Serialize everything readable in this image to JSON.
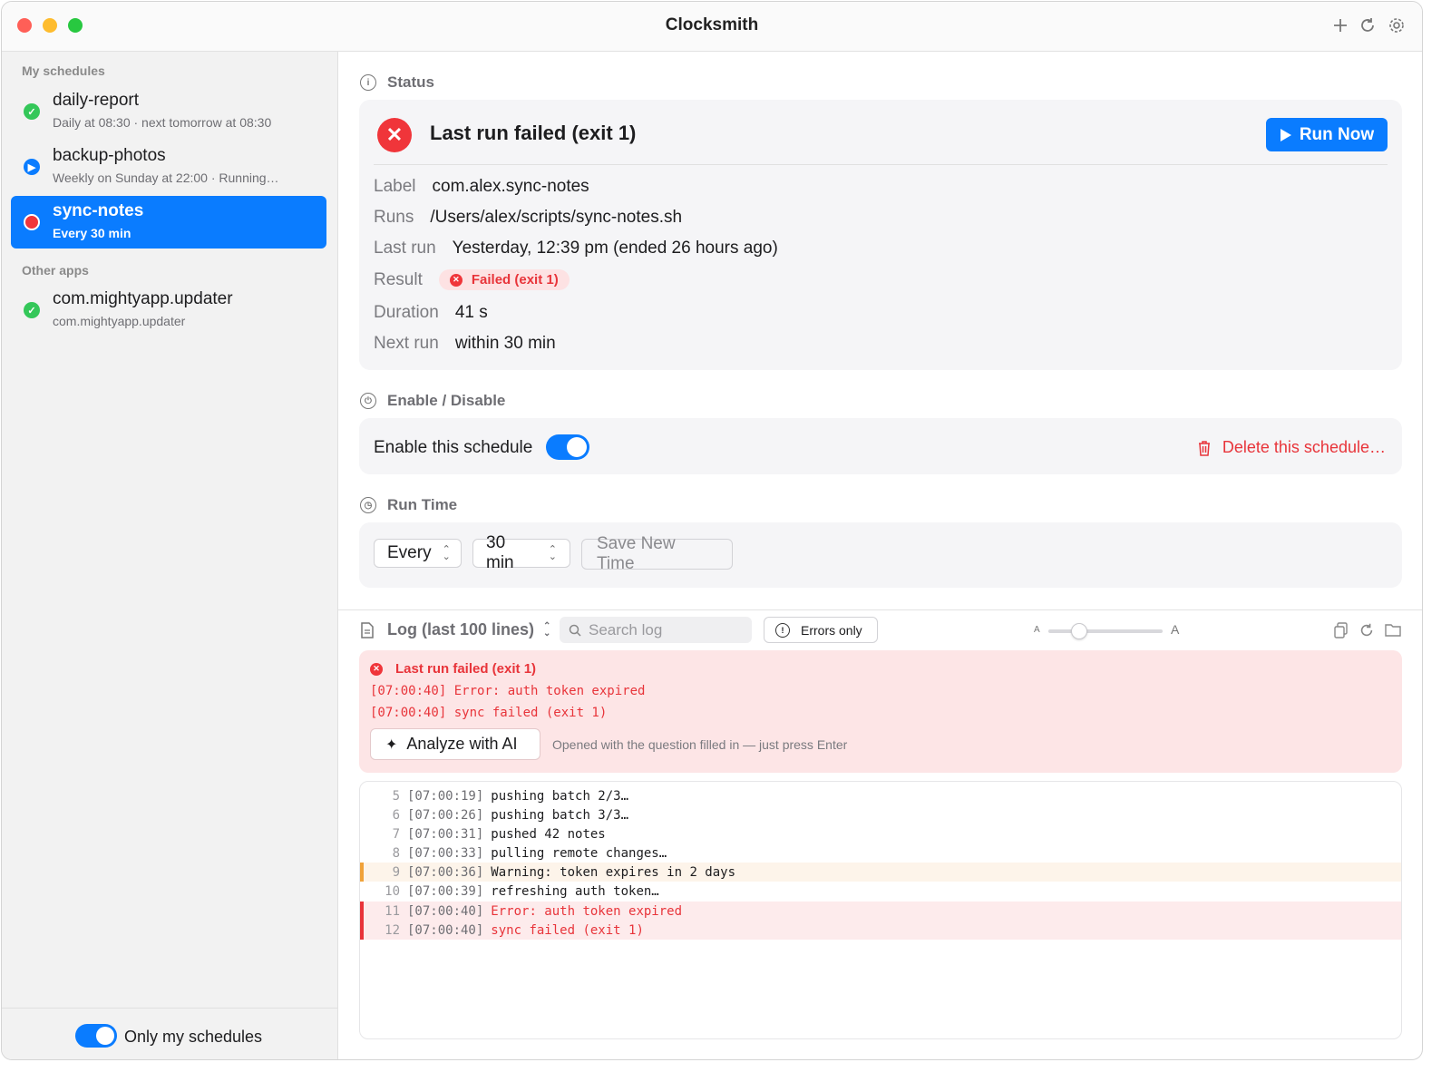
{
  "window": {
    "title": "Clocksmith"
  },
  "toolbar": {
    "add_icon": "plus-icon",
    "refresh_icon": "refresh-icon",
    "settings_icon": "gear-icon"
  },
  "sidebar": {
    "section_mine": "My schedules",
    "section_other": "Other apps",
    "items": [
      {
        "name": "daily-report",
        "sub": "Daily at 08:30 · next tomorrow at 08:30",
        "status": "ok",
        "status_color": "#34c759"
      },
      {
        "name": "backup-photos",
        "sub": "Weekly on Sunday at 22:00 · Running…",
        "status": "running",
        "status_color": "#0a7cff"
      },
      {
        "name": "sync-notes",
        "sub": "Every 30 min",
        "status": "failed",
        "status_color": "#f0353a"
      }
    ],
    "other_items": [
      {
        "name": "com.mightyapp.updater",
        "sub": "com.mightyapp.updater",
        "status": "ok",
        "status_color": "#34c759"
      }
    ],
    "footer_toggle_label": "Only my schedules",
    "footer_toggle_on": true
  },
  "status": {
    "heading": "Status",
    "title": "Last run failed (exit 1)",
    "run_now": "Run Now",
    "fields": {
      "label_key": "Label",
      "label_val": "com.alex.sync-notes",
      "runs_key": "Runs",
      "runs_val": "/Users/alex/scripts/sync-notes.sh",
      "last_run_key": "Last run",
      "last_run_val": "Yesterday, 12:39 pm (ended 26 hours ago)",
      "result_key": "Result",
      "result_val": "Failed (exit 1)",
      "duration_key": "Duration",
      "duration_val": "41 s",
      "next_run_key": "Next run",
      "next_run_val": "within 30 min"
    }
  },
  "enable": {
    "heading": "Enable / Disable",
    "toggle_label": "Enable this schedule",
    "toggle_on": true,
    "delete_label": "Delete this schedule…"
  },
  "run_time": {
    "heading": "Run Time",
    "mode_value": "Every",
    "interval_value": "30 min",
    "save_label": "Save New Time"
  },
  "log": {
    "title": "Log (last 100 lines)",
    "search_placeholder": "Search log",
    "errors_only": "Errors only",
    "font_small": "A",
    "font_large": "A",
    "error_summary": {
      "title": "Last run failed (exit 1)",
      "lines": [
        "[07:00:40] Error: auth token expired",
        "[07:00:40] sync failed (exit 1)"
      ],
      "ai_button": "Analyze with AI",
      "ai_hint": "Opened with the question filled in — just press Enter"
    },
    "lines": [
      {
        "num": "5",
        "ts": "[07:00:19]",
        "msg": "pushing batch 2/3…",
        "level": "info"
      },
      {
        "num": "6",
        "ts": "[07:00:26]",
        "msg": "pushing batch 3/3…",
        "level": "info"
      },
      {
        "num": "7",
        "ts": "[07:00:31]",
        "msg": "pushed 42 notes",
        "level": "info"
      },
      {
        "num": "8",
        "ts": "[07:00:33]",
        "msg": "pulling remote changes…",
        "level": "info"
      },
      {
        "num": "9",
        "ts": "[07:00:36]",
        "msg": "Warning: token expires in 2 days",
        "level": "warn"
      },
      {
        "num": "10",
        "ts": "[07:00:39]",
        "msg": "refreshing auth token…",
        "level": "info"
      },
      {
        "num": "11",
        "ts": "[07:00:40]",
        "msg": "Error: auth token expired",
        "level": "error"
      },
      {
        "num": "12",
        "ts": "[07:00:40]",
        "msg": "sync failed (exit 1)",
        "level": "error"
      }
    ]
  },
  "colors": {
    "accent": "#0a7cff",
    "danger": "#e8343a",
    "success": "#34c759"
  }
}
